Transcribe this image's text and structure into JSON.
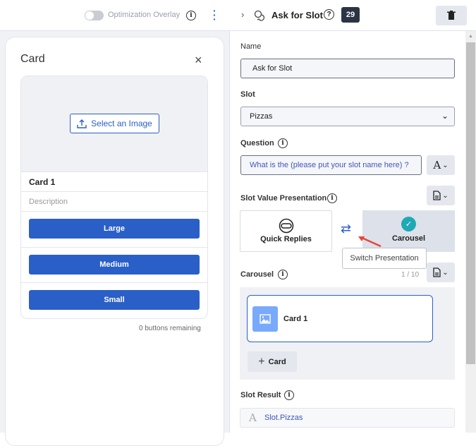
{
  "left_header": {
    "overlay_label": "Optimization Overlay",
    "overlay_on": false
  },
  "card_editor": {
    "title": "Card",
    "select_image": "Select an Image",
    "card_title": "Card 1",
    "description_placeholder": "Description",
    "buttons": [
      "Large",
      "Medium",
      "Small"
    ],
    "remaining": "0 buttons remaining"
  },
  "right_header": {
    "title": "Ask for Slot",
    "count": "29"
  },
  "form": {
    "name_label": "Name",
    "name_value": "Ask for Slot",
    "slot_label": "Slot",
    "slot_value": "Pizzas",
    "question_label": "Question",
    "question_value": "What is the (please put your slot name here) ?",
    "svp_label": "Slot Value Presentation",
    "options": [
      "Quick Replies",
      "Carousel"
    ],
    "selected": "Carousel",
    "tooltip": "Switch Presentation",
    "carousel_label": "Carousel",
    "carousel_count": "1 / 10",
    "carousel_cards": [
      "Card 1"
    ],
    "add_card": "Card",
    "result_label": "Slot Result",
    "result_value": "Slot.Pizzas"
  },
  "colors": {
    "primary": "#2a5fc7",
    "check": "#1fa9b4",
    "arrow": "#e8453c",
    "badge": "#2b3445"
  }
}
